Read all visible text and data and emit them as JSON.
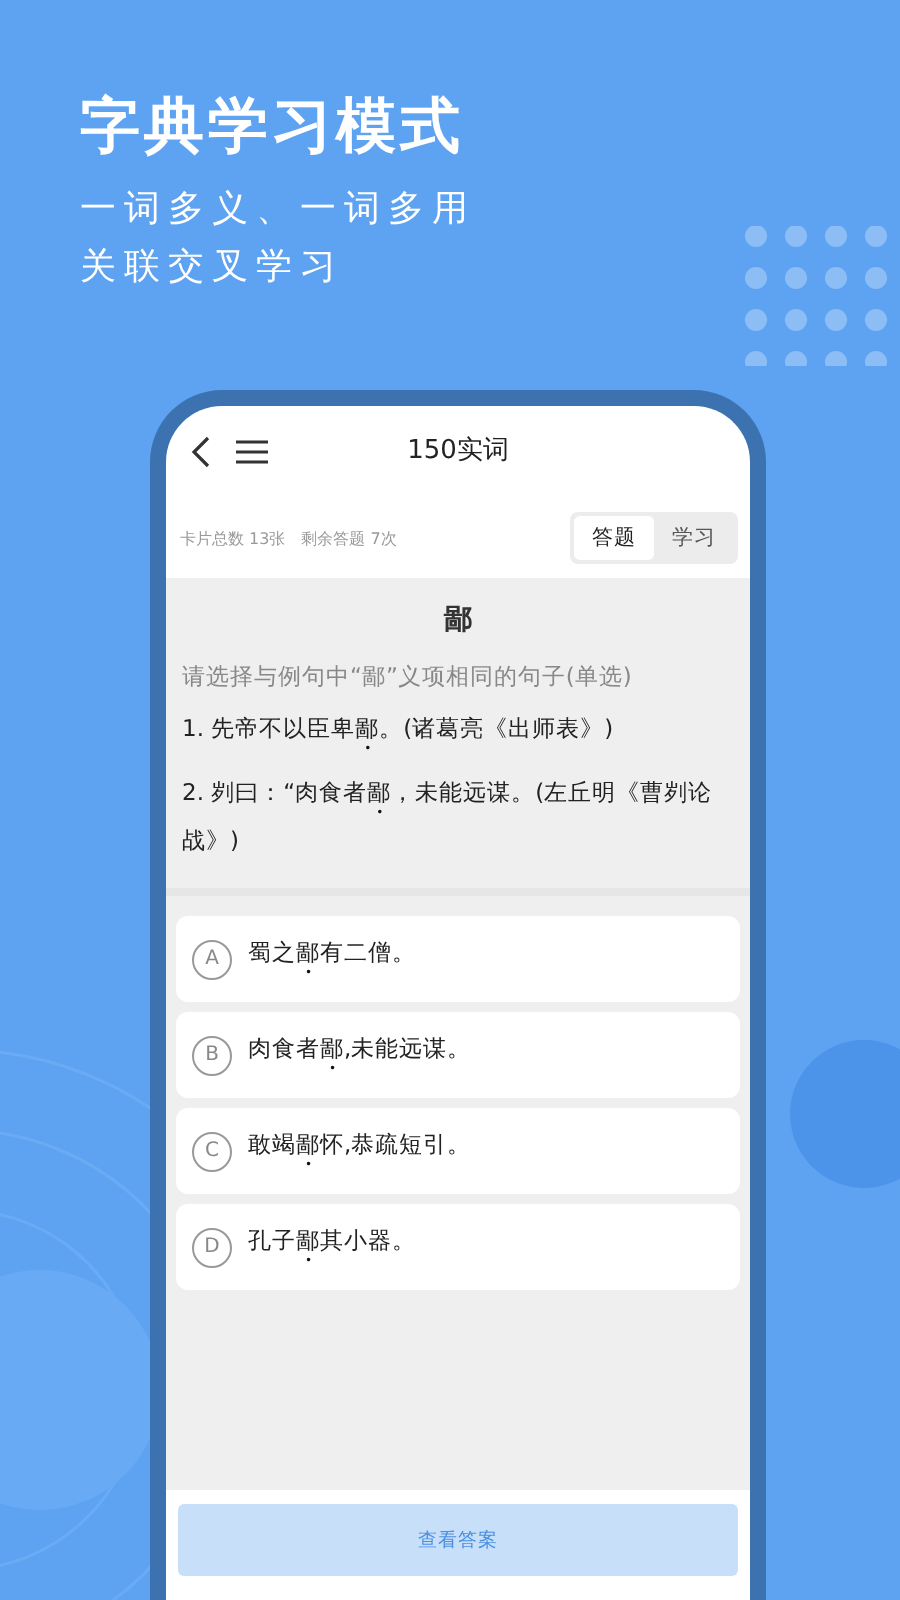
{
  "promo": {
    "title": "字典学习模式",
    "lines": [
      "一词多义、一词多用",
      "关联交叉学习"
    ]
  },
  "app": {
    "title": "150实词",
    "stats": [
      "卡片总数 13张",
      "剩余答题 7次"
    ],
    "mode_tabs": [
      {
        "label": "答题",
        "selected": true
      },
      {
        "label": "学习",
        "selected": false
      }
    ],
    "question": {
      "word": "鄙",
      "prompt": "请选择与例句中“鄙”义项相同的句子(单选)",
      "examples": [
        {
          "before": "1. 先帝不以臣卑",
          "marked": "鄙",
          "after": "。(诸葛亮《出师表》)"
        },
        {
          "before": "2. 刿曰：“肉食者",
          "marked": "鄙",
          "after": "，未能远谋。(左丘明《曹刿论战》)"
        }
      ]
    },
    "options": [
      {
        "letter": "A",
        "before": "蜀之",
        "marked": "鄙",
        "after": "有二僧。"
      },
      {
        "letter": "B",
        "before": "肉食者",
        "marked": "鄙",
        "after": ",未能远谋。"
      },
      {
        "letter": "C",
        "before": "敢竭",
        "marked": "鄙",
        "after": "怀,恭疏短引。"
      },
      {
        "letter": "D",
        "before": "孔子",
        "marked": "鄙",
        "after": "其小器。"
      }
    ],
    "answer_button": "查看答案"
  }
}
